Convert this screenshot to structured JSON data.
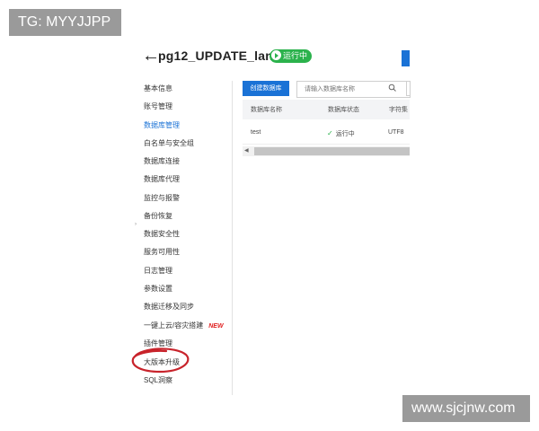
{
  "watermarks": {
    "top_left": "TG: MYYJJPP",
    "bottom_right": "www.sjcjnw.com"
  },
  "header": {
    "back_icon": "arrow-left-icon",
    "title": "pg12_UPDATE_lanlv",
    "status": "运行中",
    "status_color": "#2bb24c"
  },
  "sidebar": {
    "items": [
      {
        "label": "基本信息"
      },
      {
        "label": "账号管理"
      },
      {
        "label": "数据库管理",
        "active": true
      },
      {
        "label": "白名单与安全组"
      },
      {
        "label": "数据库连接"
      },
      {
        "label": "数据库代理"
      },
      {
        "label": "监控与报警"
      },
      {
        "label": "备份恢复"
      },
      {
        "label": "数据安全性"
      },
      {
        "label": "服务可用性"
      },
      {
        "label": "日志管理"
      },
      {
        "label": "参数设置"
      },
      {
        "label": "数据迁移及同步"
      },
      {
        "label": "一键上云/容灾搭建",
        "badge": "NEW"
      },
      {
        "label": "插件管理"
      },
      {
        "label": "大版本升级",
        "highlighted": true
      },
      {
        "label": "SQL洞察"
      }
    ]
  },
  "toolbar": {
    "create_label": "创建数据库",
    "search_placeholder": "请输入数据库名称"
  },
  "table": {
    "columns": [
      "数据库名称",
      "数据库状态",
      "字符集"
    ],
    "rows": [
      {
        "name": "test",
        "status": "运行中",
        "charset": "UTF8"
      }
    ]
  },
  "colors": {
    "accent": "#1a72d6",
    "annotation": "#c8232b",
    "new_badge": "#e02020"
  }
}
